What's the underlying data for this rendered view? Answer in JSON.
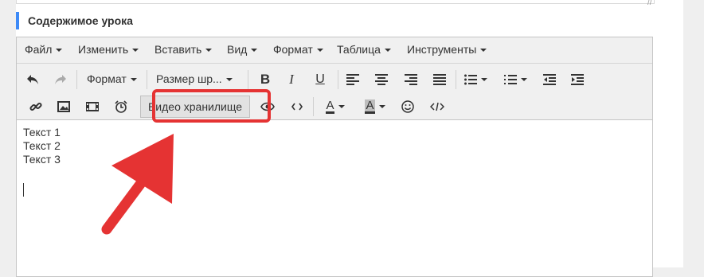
{
  "section": {
    "title": "Содержимое урока"
  },
  "menubar": {
    "items": [
      {
        "label": "Файл"
      },
      {
        "label": "Изменить"
      },
      {
        "label": "Вставить"
      },
      {
        "label": "Вид"
      },
      {
        "label": "Формат"
      },
      {
        "label": "Таблица"
      },
      {
        "label": "Инструменты"
      }
    ]
  },
  "toolbar": {
    "format_dropdown": "Формат",
    "font_size_dropdown": "Размер шр...",
    "video_storage_button": "Видео хранилище",
    "icons": [
      "undo-icon",
      "redo-icon",
      "bold-icon",
      "italic-icon",
      "underline-icon",
      "align-left-icon",
      "align-center-icon",
      "align-right-icon",
      "align-justify-icon",
      "bullet-list-icon",
      "numbered-list-icon",
      "outdent-icon",
      "indent-icon",
      "link-icon",
      "image-icon",
      "media-icon",
      "alarm-clock-icon",
      "preview-icon",
      "code-icon",
      "text-color-icon",
      "background-color-icon",
      "emoticon-icon",
      "source-code-icon"
    ],
    "text_color_letter": "A",
    "bg_color_letter": "A"
  },
  "editor": {
    "lines": [
      "Текст 1",
      "Текст 2",
      "Текст 3"
    ]
  },
  "colors": {
    "accent": "#3d8af7",
    "highlight": "#e53333"
  }
}
